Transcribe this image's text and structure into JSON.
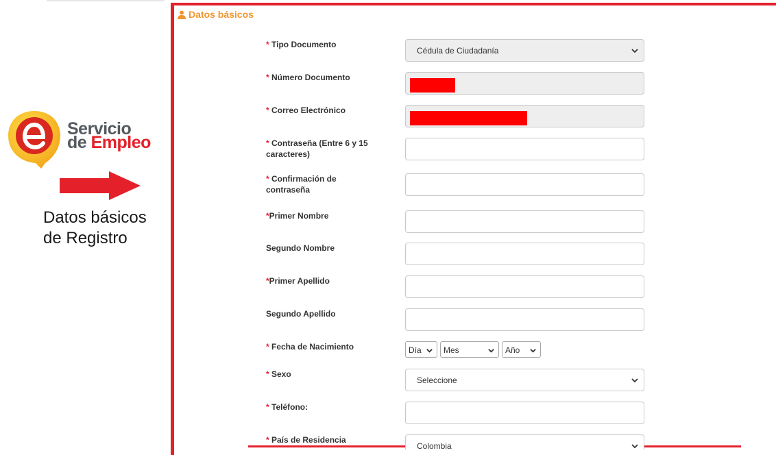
{
  "promo": {
    "logo_line1": "Servicio",
    "logo_line2_prefix": "de ",
    "logo_line2_accent": "Empleo",
    "caption_line1": "Datos básicos",
    "caption_line2": "de Registro"
  },
  "section": {
    "title": "Datos básicos",
    "icon": "user-icon"
  },
  "form": {
    "required_mark": "*",
    "tipo_documento": {
      "label": " Tipo Documento",
      "value": "Cédula de Ciudadanía"
    },
    "numero_documento": {
      "label": " Número Documento"
    },
    "correo": {
      "label": " Correo Electrónico"
    },
    "contrasena": {
      "label_line1": " Contraseña (Entre 6 y 15",
      "label_line2": "caracteres)"
    },
    "confirmacion": {
      "label_line1": " Confirmación de",
      "label_line2": "contraseña"
    },
    "primer_nombre": {
      "label": "Primer Nombre"
    },
    "segundo_nombre": {
      "label": "Segundo Nombre"
    },
    "primer_apellido": {
      "label": "Primer Apellido"
    },
    "segundo_apellido": {
      "label": "Segundo Apellido"
    },
    "fecha_nacimiento": {
      "label": " Fecha de Nacimiento",
      "dia": "Día",
      "mes": "Mes",
      "anio": "Año"
    },
    "sexo": {
      "label": " Sexo",
      "value": "Seleccione"
    },
    "telefono": {
      "label": " Teléfono:"
    },
    "pais": {
      "label": " País de Residencia",
      "value": "Colombia"
    }
  },
  "colors": {
    "accent_red": "#e4212b",
    "title_orange": "#f0962e",
    "redaction": "#ff0000"
  }
}
